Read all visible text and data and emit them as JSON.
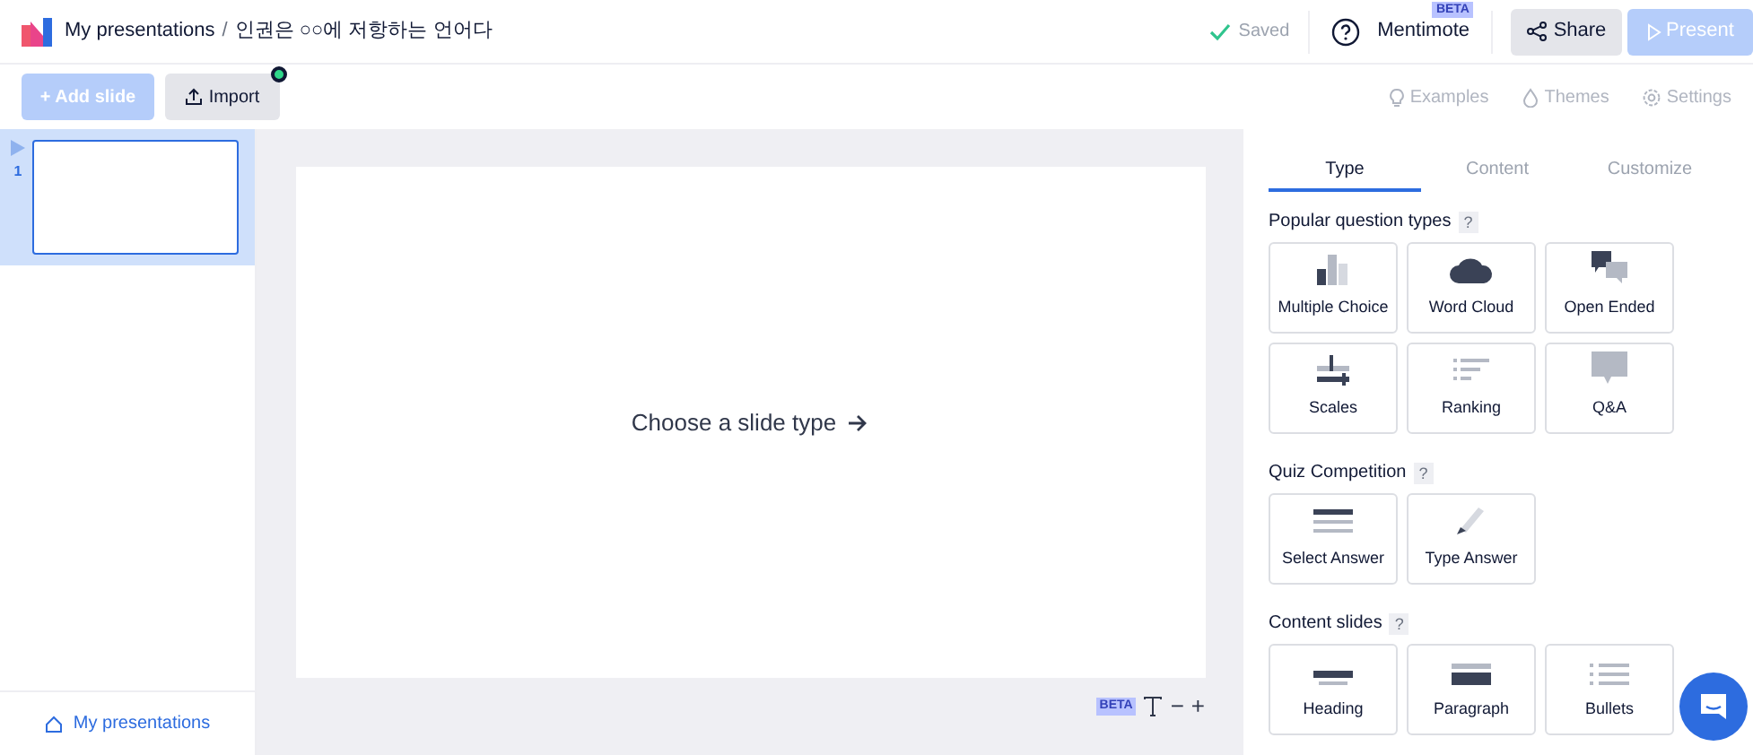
{
  "header": {
    "breadcrumb_root": "My presentations",
    "separator": "/",
    "title": "인권은 ○○에 저항하는 언어다",
    "saved": "Saved",
    "mentimote": "Mentimote",
    "mentimote_badge": "BETA",
    "share": "Share",
    "present": "Present"
  },
  "toolbar": {
    "add_slide": "+ Add slide",
    "import": "Import",
    "links": [
      "Examples",
      "Themes",
      "Settings"
    ]
  },
  "slides": [
    {
      "number": "1",
      "selected": true
    }
  ],
  "sidebar_footer": "My presentations",
  "canvas": {
    "prompt": "Choose a slide type",
    "zoom_badge": "BETA",
    "zoom_minus": "−",
    "zoom_plus": "+"
  },
  "tabs": [
    {
      "label": "Type",
      "selected": true
    },
    {
      "label": "Content",
      "selected": false
    },
    {
      "label": "Customize",
      "selected": false
    }
  ],
  "sections": [
    {
      "title": "Popular question types",
      "help": "?",
      "tiles": [
        "Multiple Choice",
        "Word Cloud",
        "Open Ended",
        "Scales",
        "Ranking",
        "Q&A"
      ]
    },
    {
      "title": "Quiz Competition",
      "help": "?",
      "tiles": [
        "Select Answer",
        "Type Answer"
      ]
    },
    {
      "title": "Content slides",
      "help": "?",
      "tiles": [
        "Heading",
        "Paragraph",
        "Bullets"
      ]
    }
  ]
}
